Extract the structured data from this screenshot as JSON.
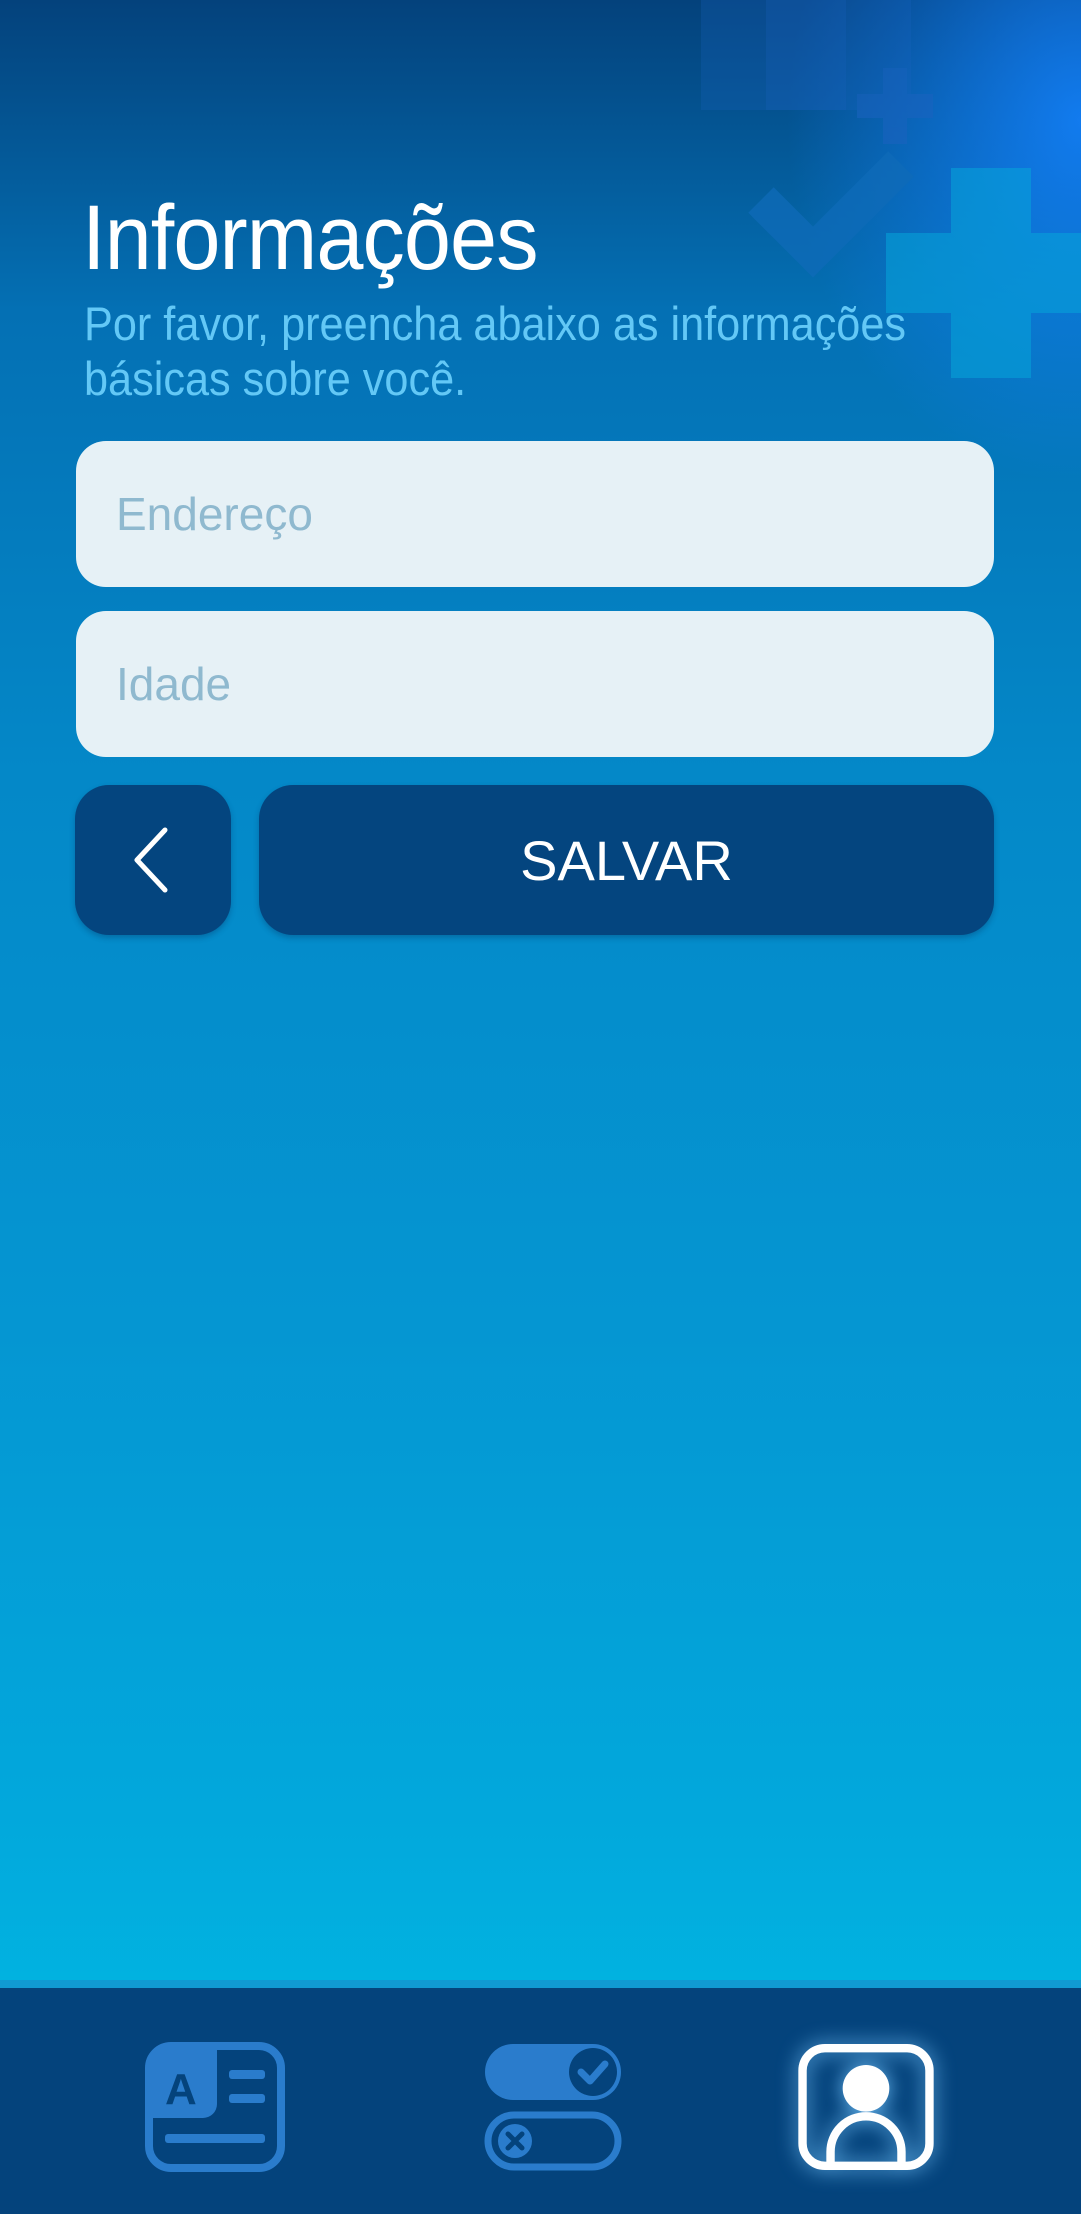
{
  "header": {
    "title": "Informações",
    "subtitle": "Por favor, preencha abaixo as informações básicas sobre você."
  },
  "form": {
    "address": {
      "placeholder": "Endereço",
      "value": ""
    },
    "age": {
      "placeholder": "Idade",
      "value": ""
    },
    "save_label": "SALVAR",
    "back_icon": "chevron-left-icon"
  },
  "bottom_nav": {
    "items": [
      {
        "icon": "document-card-icon",
        "active": false
      },
      {
        "icon": "toggles-icon",
        "active": false
      },
      {
        "icon": "profile-icon",
        "active": true
      }
    ]
  },
  "colors": {
    "background_top": "#04427c",
    "background_bottom": "#00c0e6",
    "subtitle": "#63c8f6",
    "button": "#04457f",
    "field": "#e6f1f6",
    "nav": "#04437c",
    "nav_icon": "#2a7ccc"
  }
}
